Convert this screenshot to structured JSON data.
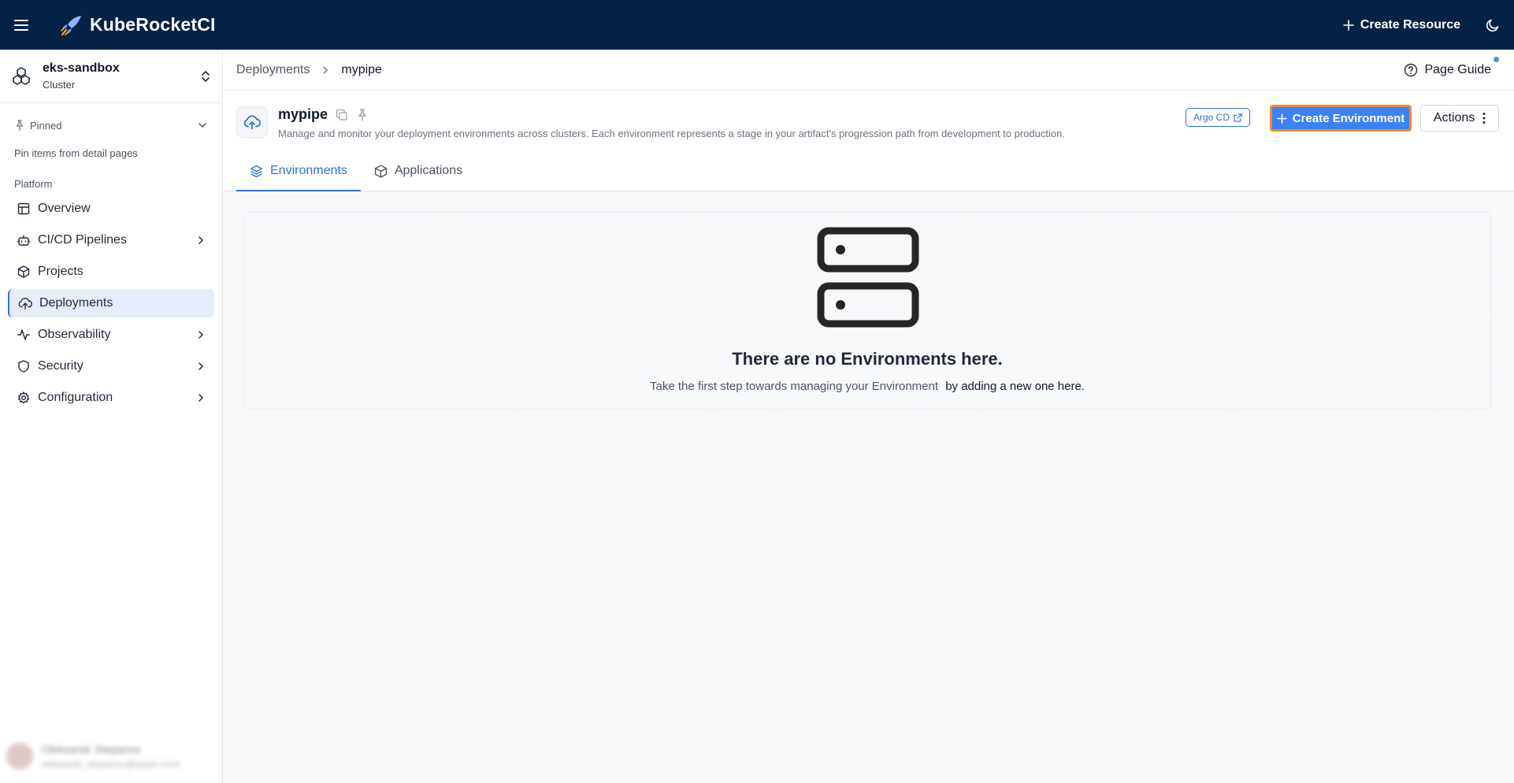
{
  "app": {
    "name": "KubeRocketCI",
    "create_resource_label": "Create Resource"
  },
  "sidebar": {
    "cluster": {
      "name": "eks-sandbox",
      "type": "Cluster"
    },
    "pinned": {
      "label": "Pinned",
      "hint": "Pin items from detail pages"
    },
    "section_label": "Platform",
    "items": [
      {
        "label": "Overview",
        "icon": "layout-icon"
      },
      {
        "label": "CI/CD Pipelines",
        "icon": "bot-icon"
      },
      {
        "label": "Projects",
        "icon": "box-icon"
      },
      {
        "label": "Deployments",
        "icon": "cloud-upload-icon"
      },
      {
        "label": "Observability",
        "icon": "activity-icon"
      },
      {
        "label": "Security",
        "icon": "shield-icon"
      },
      {
        "label": "Configuration",
        "icon": "gear-icon"
      }
    ],
    "active_item": "Deployments",
    "user": {
      "name": "Oleksandr Stepanov",
      "email": "oleksandr_stepanov@epam.com"
    }
  },
  "breadcrumb": {
    "parent": "Deployments",
    "current": "mypipe",
    "page_guide_label": "Page Guide"
  },
  "header": {
    "title": "mypipe",
    "description": "Manage and monitor your deployment environments across clusters. Each environment represents a stage in your artifact's progression path from development to production.",
    "argo_label": "Argo CD",
    "create_label": "Create Environment",
    "actions_label": "Actions"
  },
  "tabs": [
    {
      "label": "Environments",
      "active": true
    },
    {
      "label": "Applications",
      "active": false
    }
  ],
  "empty_state": {
    "title": "There are no Environments here.",
    "text": "Take the first step towards managing your Environment",
    "link": "by adding a new one here."
  },
  "colors": {
    "topbar": "#032245",
    "accent": "#3b82f6",
    "highlight": "#f28c28"
  }
}
